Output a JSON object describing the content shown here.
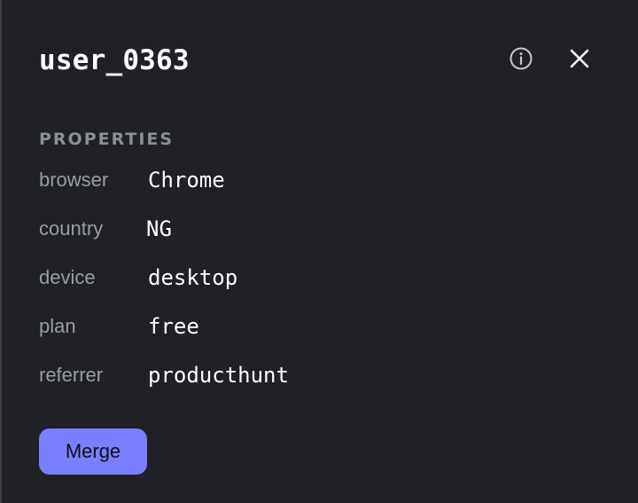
{
  "panel": {
    "title": "user_0363",
    "info_icon": "info-circle-icon",
    "close_icon": "close-x-icon"
  },
  "properties": {
    "heading": "PROPERTIES",
    "items": [
      {
        "key": "browser",
        "value": "Chrome"
      },
      {
        "key": "country",
        "value": "NG"
      },
      {
        "key": "device",
        "value": "desktop"
      },
      {
        "key": "plan",
        "value": "free"
      },
      {
        "key": "referrer",
        "value": "producthunt"
      }
    ]
  },
  "actions": {
    "merge_label": "Merge"
  },
  "colors": {
    "background": "#1f2126",
    "accent": "#7b7fff",
    "muted_text": "#9a9da4",
    "heading_text": "#8c8f96"
  }
}
